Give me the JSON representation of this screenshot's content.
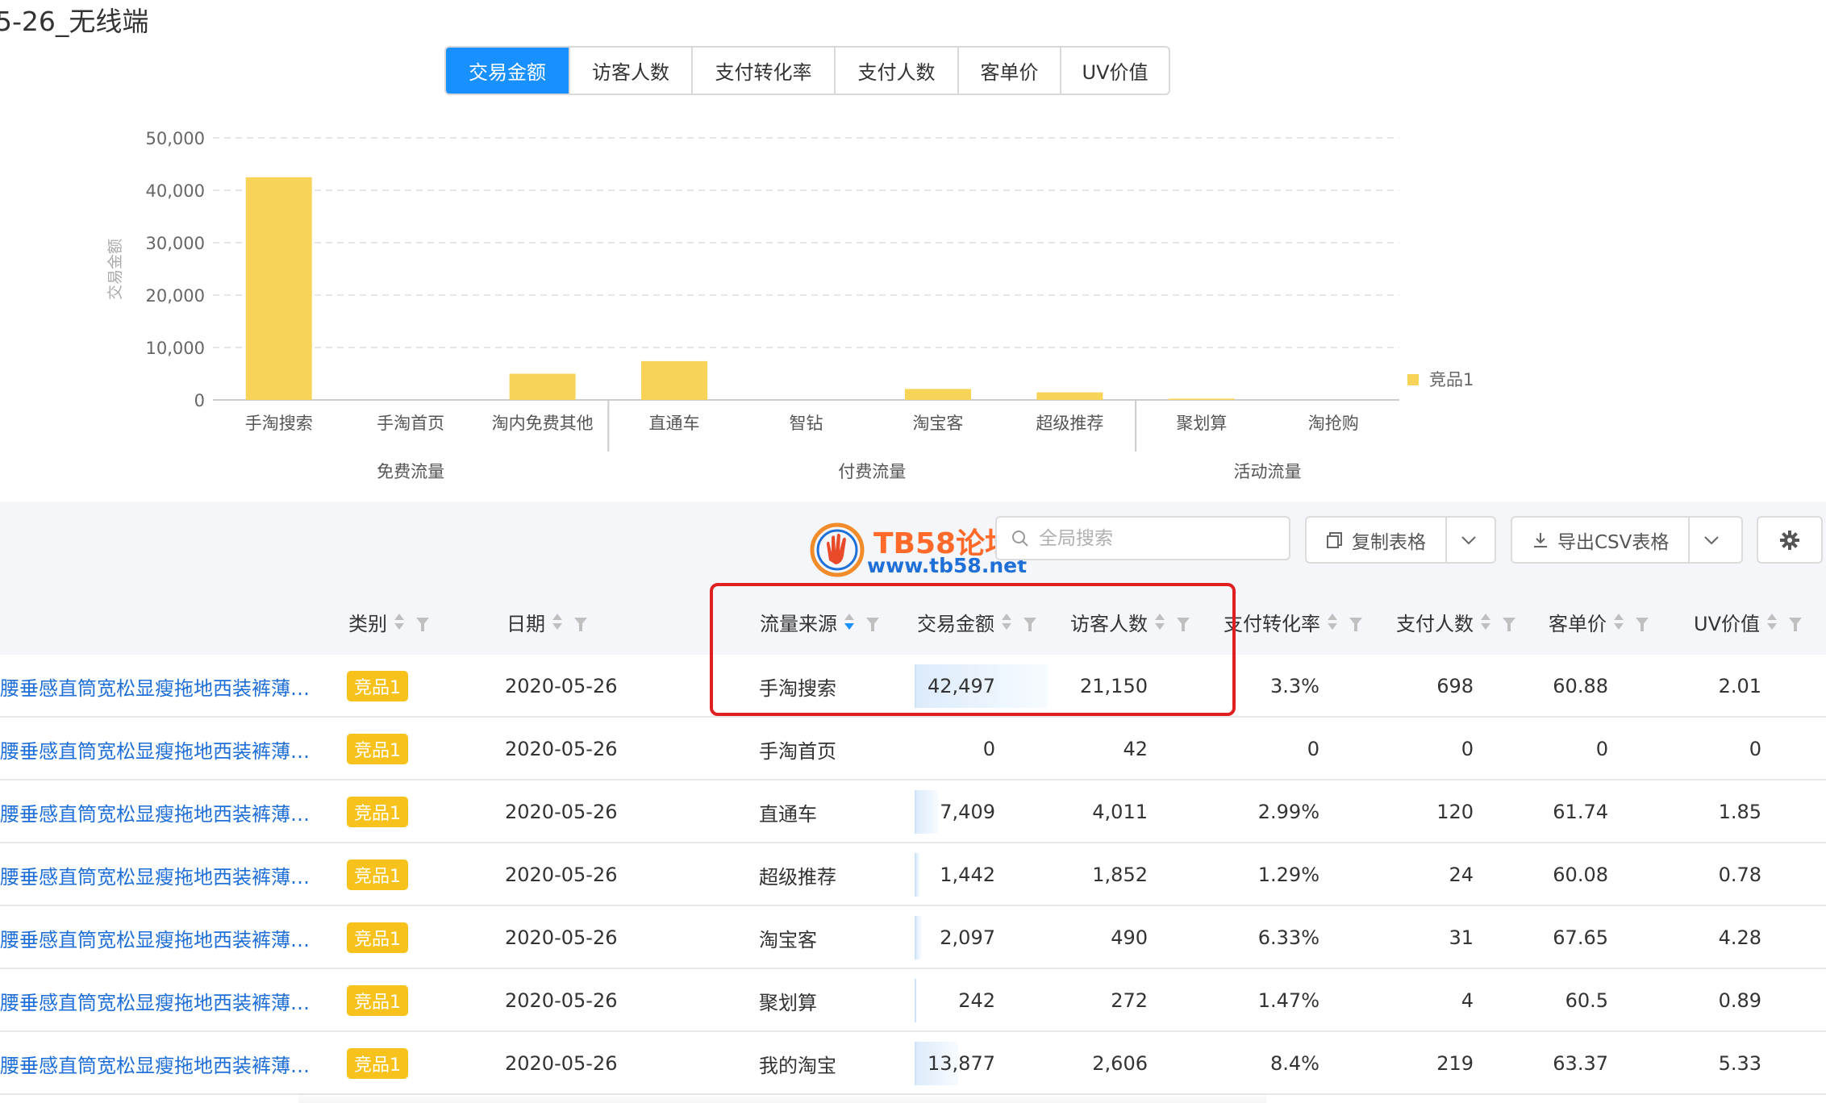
{
  "page_title": "5-26_无线端",
  "tabs": [
    {
      "label": "交易金额",
      "active": true
    },
    {
      "label": "访客人数",
      "active": false
    },
    {
      "label": "支付转化率",
      "active": false
    },
    {
      "label": "支付人数",
      "active": false
    },
    {
      "label": "客单价",
      "active": false
    },
    {
      "label": "UV价值",
      "active": false
    }
  ],
  "chart_data": {
    "type": "bar",
    "ylabel": "交易金额",
    "ylim": [
      0,
      50000
    ],
    "yticks": [
      "0",
      "10,000",
      "20,000",
      "30,000",
      "40,000",
      "50,000"
    ],
    "categories": [
      "手淘搜索",
      "手淘首页",
      "淘内免费其他",
      "直通车",
      "智钻",
      "淘宝客",
      "超级推荐",
      "聚划算",
      "淘抢购"
    ],
    "groups": [
      {
        "label": "免费流量",
        "start": 0,
        "end": 2
      },
      {
        "label": "付费流量",
        "start": 3,
        "end": 6
      },
      {
        "label": "活动流量",
        "start": 7,
        "end": 8
      }
    ],
    "series": [
      {
        "name": "竞品1",
        "color": "#f7d358",
        "values": [
          42497,
          0,
          5000,
          7409,
          0,
          2097,
          1442,
          242,
          0
        ]
      }
    ],
    "legend_position": "right",
    "grid": true
  },
  "toolbar": {
    "logo_name": "TB58论坛",
    "logo_url": "www.tb58.net",
    "search_placeholder": "全局搜索",
    "copy_label": "复制表格",
    "export_label": "导出CSV表格"
  },
  "table": {
    "headers": {
      "category": "类别",
      "date": "日期",
      "source": "流量来源",
      "amount": "交易金额",
      "visitors": "访客人数",
      "conversion": "支付转化率",
      "payers": "支付人数",
      "unit_price": "客单价",
      "uv_value": "UV价值"
    },
    "rows": [
      {
        "product": "腰垂感直筒宽松显瘦拖地西装裤薄…",
        "category": "竞品1",
        "date": "2020-05-26",
        "source": "手淘搜索",
        "amount": "42,497",
        "amount_value": 42497,
        "visitors": "21,150",
        "conversion": "3.3%",
        "payers": "698",
        "unit_price": "60.88",
        "uv_value": "2.01"
      },
      {
        "product": "腰垂感直筒宽松显瘦拖地西装裤薄…",
        "category": "竞品1",
        "date": "2020-05-26",
        "source": "手淘首页",
        "amount": "0",
        "amount_value": 0,
        "visitors": "42",
        "conversion": "0",
        "payers": "0",
        "unit_price": "0",
        "uv_value": "0"
      },
      {
        "product": "腰垂感直筒宽松显瘦拖地西装裤薄…",
        "category": "竞品1",
        "date": "2020-05-26",
        "source": "直通车",
        "amount": "7,409",
        "amount_value": 7409,
        "visitors": "4,011",
        "conversion": "2.99%",
        "payers": "120",
        "unit_price": "61.74",
        "uv_value": "1.85"
      },
      {
        "product": "腰垂感直筒宽松显瘦拖地西装裤薄…",
        "category": "竞品1",
        "date": "2020-05-26",
        "source": "超级推荐",
        "amount": "1,442",
        "amount_value": 1442,
        "visitors": "1,852",
        "conversion": "1.29%",
        "payers": "24",
        "unit_price": "60.08",
        "uv_value": "0.78"
      },
      {
        "product": "腰垂感直筒宽松显瘦拖地西装裤薄…",
        "category": "竞品1",
        "date": "2020-05-26",
        "source": "淘宝客",
        "amount": "2,097",
        "amount_value": 2097,
        "visitors": "490",
        "conversion": "6.33%",
        "payers": "31",
        "unit_price": "67.65",
        "uv_value": "4.28"
      },
      {
        "product": "腰垂感直筒宽松显瘦拖地西装裤薄…",
        "category": "竞品1",
        "date": "2020-05-26",
        "source": "聚划算",
        "amount": "242",
        "amount_value": 242,
        "visitors": "272",
        "conversion": "1.47%",
        "payers": "4",
        "unit_price": "60.5",
        "uv_value": "0.89"
      },
      {
        "product": "腰垂感直筒宽松显瘦拖地西装裤薄…",
        "category": "竞品1",
        "date": "2020-05-26",
        "source": "我的淘宝",
        "amount": "13,877",
        "amount_value": 13877,
        "visitors": "2,606",
        "conversion": "8.4%",
        "payers": "219",
        "unit_price": "63.37",
        "uv_value": "5.33"
      }
    ]
  },
  "colors": {
    "accent": "#1890ff",
    "bar": "#f7d358",
    "badge": "#f7c21b",
    "highlight": "#e02020",
    "link": "#1f6fd8"
  }
}
